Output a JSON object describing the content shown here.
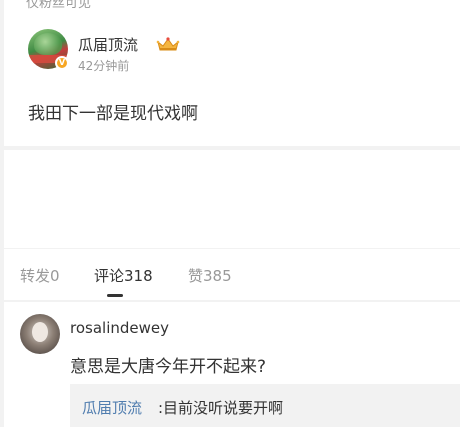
{
  "post": {
    "visibility": "仅粉丝可见",
    "author": "瓜届顶流",
    "vip_badge": "V",
    "time": "42分钟前",
    "text": "我田下一部是现代戏啊"
  },
  "tabs": [
    {
      "label": "转发0"
    },
    {
      "label": "评论318"
    },
    {
      "label": "赞385"
    }
  ],
  "comment": {
    "author": "rosalindewey",
    "text": "意思是大唐今年开不起来?",
    "reply": {
      "author": "瓜届顶流",
      "text": ":目前没听说要开啊"
    }
  },
  "colors": {
    "page_bg": "#f2f2f2",
    "link": "#507daf",
    "muted": "#999999",
    "vip": "#f7a623"
  }
}
